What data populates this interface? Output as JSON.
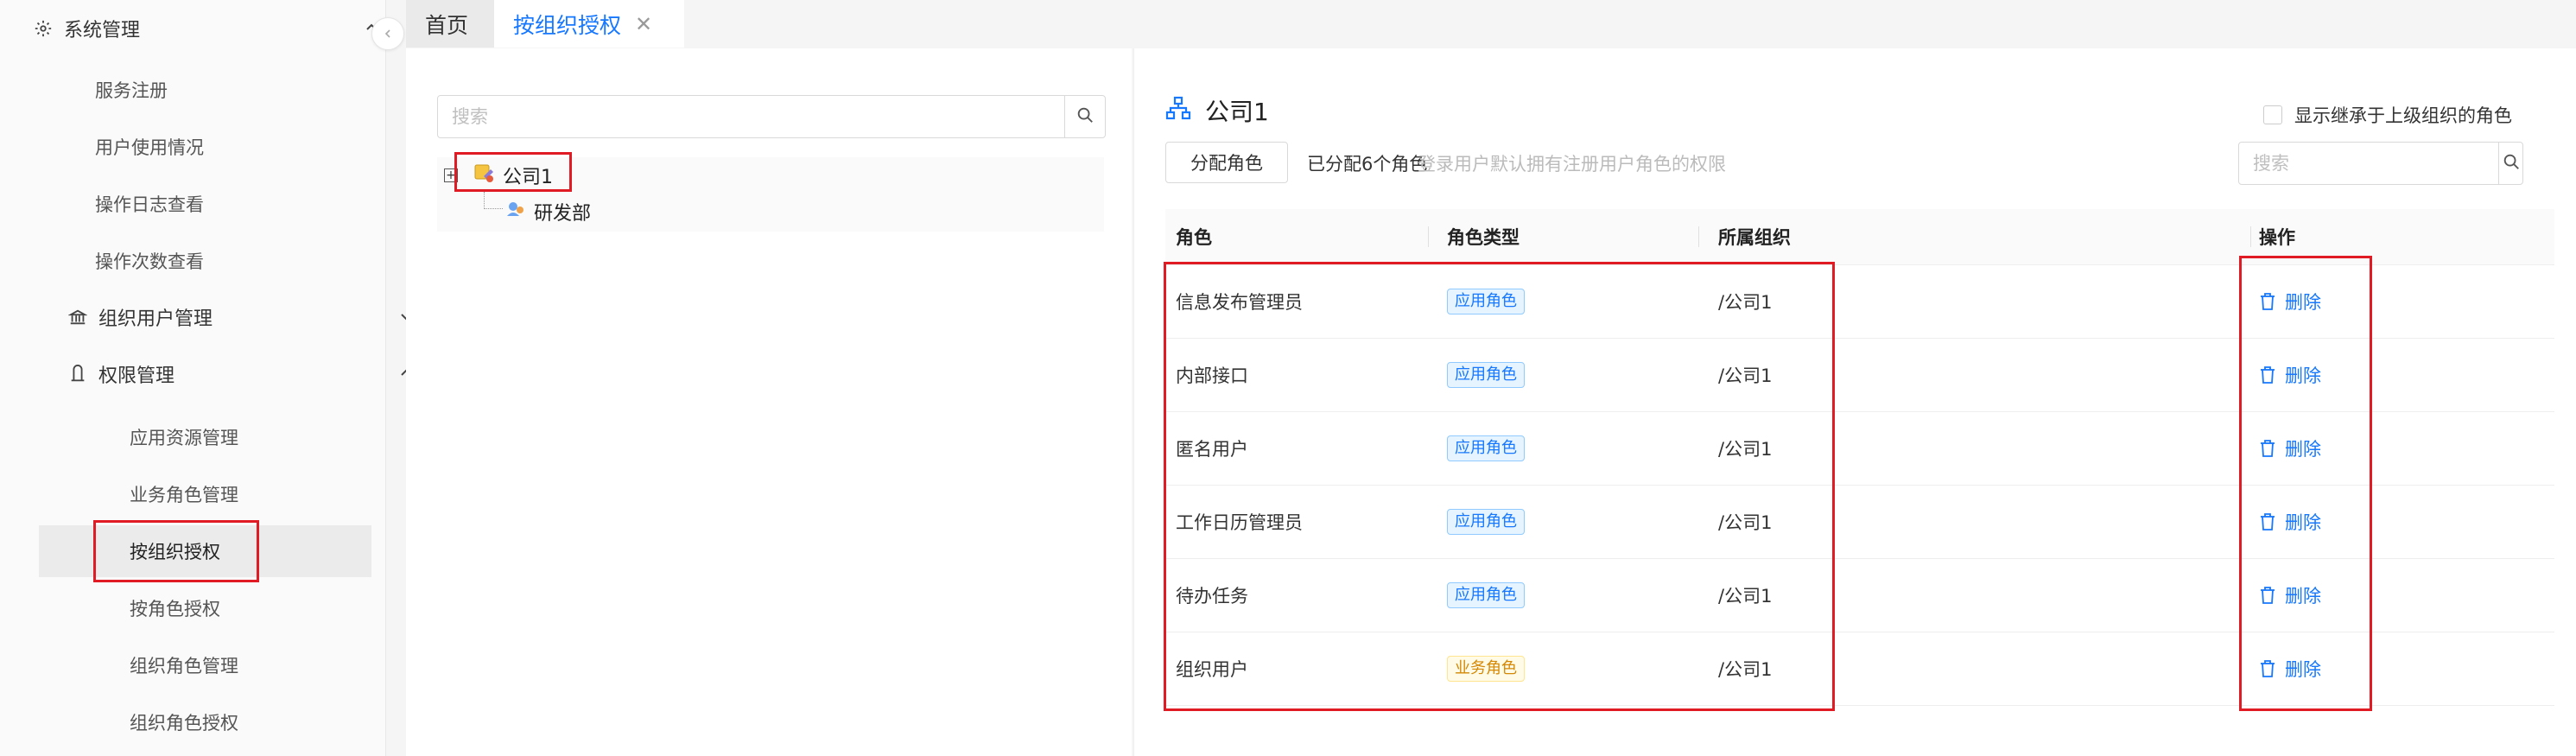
{
  "sidebar": {
    "groups": [
      {
        "label": "系统管理",
        "icon": "gear-icon"
      },
      {
        "label": "组织用户管理",
        "icon": "bank-icon"
      },
      {
        "label": "权限管理",
        "icon": "user-icon"
      }
    ],
    "items": [
      {
        "label": "服务注册"
      },
      {
        "label": "用户使用情况"
      },
      {
        "label": "操作日志查看"
      },
      {
        "label": "操作次数查看"
      }
    ],
    "sub_items": [
      {
        "label": "应用资源管理"
      },
      {
        "label": "业务角色管理"
      },
      {
        "label": "按组织授权"
      },
      {
        "label": "按角色授权"
      },
      {
        "label": "组织角色管理"
      },
      {
        "label": "组织角色授权"
      }
    ]
  },
  "tabs": {
    "home": "首页",
    "current": "按组织授权",
    "close_glyph": "✕"
  },
  "tree": {
    "search_placeholder": "搜索",
    "expander_glyph": "+",
    "root": "公司1",
    "child": "研发部"
  },
  "detail": {
    "org_name": "公司1",
    "assign_button": "分配角色",
    "assigned_text": "已分配6个角色",
    "hint": "登录用户默认拥有注册用户角色的权限",
    "show_inherited_label": "显示继承于上级组织的角色",
    "search_placeholder": "搜索"
  },
  "table": {
    "headers": {
      "role": "角色",
      "type": "角色类型",
      "org": "所属组织",
      "action": "操作"
    },
    "rows": [
      {
        "role": "信息发布管理员",
        "type": "应用角色",
        "type_kind": "app",
        "org": "/公司1",
        "action": "删除"
      },
      {
        "role": "内部接口",
        "type": "应用角色",
        "type_kind": "app",
        "org": "/公司1",
        "action": "删除"
      },
      {
        "role": "匿名用户",
        "type": "应用角色",
        "type_kind": "app",
        "org": "/公司1",
        "action": "删除"
      },
      {
        "role": "工作日历管理员",
        "type": "应用角色",
        "type_kind": "app",
        "org": "/公司1",
        "action": "删除"
      },
      {
        "role": "待办任务",
        "type": "应用角色",
        "type_kind": "app",
        "org": "/公司1",
        "action": "删除"
      },
      {
        "role": "组织用户",
        "type": "业务角色",
        "type_kind": "biz",
        "org": "/公司1",
        "action": "删除"
      }
    ]
  },
  "colors": {
    "accent": "#1677ff",
    "highlight_red": "#e01b24",
    "app_tag": "#1677ff",
    "biz_tag": "#d48806"
  }
}
